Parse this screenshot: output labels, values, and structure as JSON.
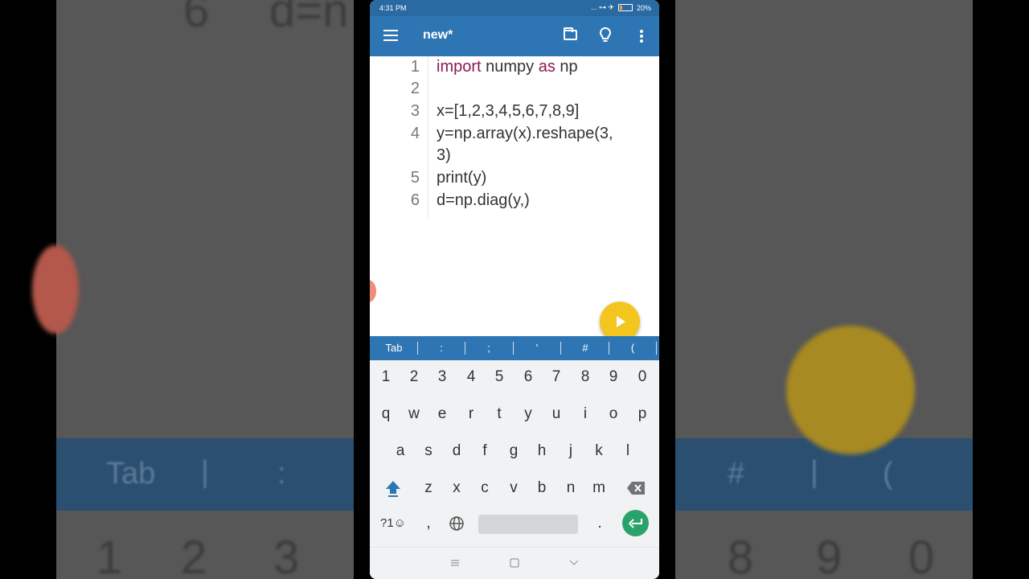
{
  "status_bar": {
    "time": "4:31 PM",
    "indicators": "... ⊶ ✈",
    "battery": "20%"
  },
  "app_bar": {
    "title": "new*"
  },
  "editor": {
    "lines": [
      {
        "num": "1",
        "kw1": "import",
        "mid": " numpy ",
        "kw2": "as",
        "rest": " np"
      },
      {
        "num": "2",
        "text": ""
      },
      {
        "num": "3",
        "text": "x=[1,2,3,4,5,6,7,8,9]"
      },
      {
        "num": "4",
        "text": "y=np.array(x).reshape(3,",
        "cont": "3)"
      },
      {
        "num": "5",
        "text": "print(y)"
      },
      {
        "num": "6",
        "text": "d=np.diag(y,)"
      }
    ]
  },
  "symbol_bar": [
    "Tab",
    ":",
    ";",
    "'",
    "#",
    "("
  ],
  "keyboard": {
    "row_numbers": [
      "1",
      "2",
      "3",
      "4",
      "5",
      "6",
      "7",
      "8",
      "9",
      "0"
    ],
    "row1": [
      "q",
      "w",
      "e",
      "r",
      "t",
      "y",
      "u",
      "i",
      "o",
      "p"
    ],
    "row2": [
      "a",
      "s",
      "d",
      "f",
      "g",
      "h",
      "j",
      "k",
      "l"
    ],
    "row3": [
      "z",
      "x",
      "c",
      "v",
      "b",
      "n",
      "m"
    ],
    "symbols_key": "?1☺",
    "comma": ",",
    "period": "."
  },
  "background": {
    "left_numbers": [
      "6",
      "d=n",
      "1",
      "2",
      "3"
    ],
    "right_numbers": [
      "8",
      "9",
      "0"
    ],
    "left_band": [
      "Tab",
      "|",
      ":"
    ],
    "right_band": [
      "#",
      "|",
      "("
    ]
  },
  "colors": {
    "accent": "#2e76b3",
    "fab": "#f3c51f",
    "keyword": "#8a1b4f",
    "enter": "#2aa36b"
  }
}
